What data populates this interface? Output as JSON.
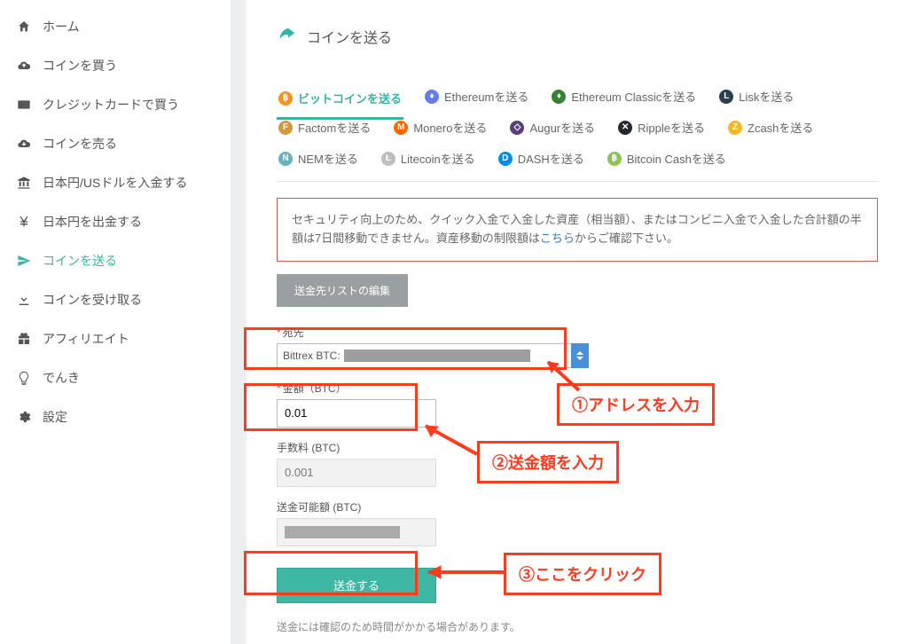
{
  "sidebar": {
    "items": [
      {
        "label": "ホーム"
      },
      {
        "label": "コインを買う"
      },
      {
        "label": "クレジットカードで買う"
      },
      {
        "label": "コインを売る"
      },
      {
        "label": "日本円/USドルを入金する"
      },
      {
        "label": "日本円を出金する"
      },
      {
        "label": "コインを送る"
      },
      {
        "label": "コインを受け取る"
      },
      {
        "label": "アフィリエイト"
      },
      {
        "label": "でんき"
      },
      {
        "label": "設定"
      }
    ]
  },
  "page": {
    "title": "コインを送る",
    "foot_note": "送金には確認のため時間がかかる場合があります。"
  },
  "coin_tabs": [
    {
      "label": "ビットコインを送る"
    },
    {
      "label": "Ethereumを送る"
    },
    {
      "label": "Ethereum Classicを送る"
    },
    {
      "label": "Liskを送る"
    },
    {
      "label": "Factomを送る"
    },
    {
      "label": "Moneroを送る"
    },
    {
      "label": "Augurを送る"
    },
    {
      "label": "Rippleを送る"
    },
    {
      "label": "Zcashを送る"
    },
    {
      "label": "NEMを送る"
    },
    {
      "label": "Litecoinを送る"
    },
    {
      "label": "DASHを送る"
    },
    {
      "label": "Bitcoin Cashを送る"
    }
  ],
  "notice": {
    "text_a": "セキュリティ向上のため、クイック入金で入金した資産（相当額）、またはコンビニ入金で入金した合計額の半額は7日間移動できません。資産移動の制限額は",
    "link": "こちら",
    "text_b": "からご確認下さい。"
  },
  "buttons": {
    "edit_list": "送金先リストの編集",
    "submit": "送金する"
  },
  "form": {
    "addr_label": "宛先",
    "addr_value": "Bittrex BTC:",
    "amount_label": "金額（BTC）",
    "amount_value": "0.01",
    "fee_label": "手数料 (BTC)",
    "fee_value": "0.001",
    "avail_label": "送金可能額 (BTC)"
  },
  "callouts": {
    "c1": "①アドレスを入力",
    "c2": "②送金額を入力",
    "c3": "③ここをクリック"
  }
}
